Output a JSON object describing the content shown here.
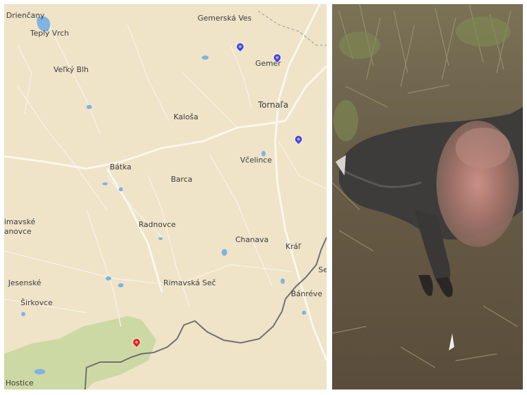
{
  "map": {
    "places": [
      {
        "id": "driencany",
        "name": "Drienčany"
      },
      {
        "id": "teply-vrch",
        "name": "Teplý Vrch"
      },
      {
        "id": "velky-blh",
        "name": "Veľký Blh"
      },
      {
        "id": "gemerska-ves",
        "name": "Gemerská Ves"
      },
      {
        "id": "gemer",
        "name": "Gemer"
      },
      {
        "id": "tornala",
        "name": "Tornaľa"
      },
      {
        "id": "kalosa",
        "name": "Kaloša"
      },
      {
        "id": "vcelince",
        "name": "Včelince"
      },
      {
        "id": "batka",
        "name": "Bátka"
      },
      {
        "id": "barca",
        "name": "Barca"
      },
      {
        "id": "rimavske-janovce-1",
        "name": "imavské"
      },
      {
        "id": "rimavske-janovce-2",
        "name": "anovce"
      },
      {
        "id": "radnovce",
        "name": "Radnovce"
      },
      {
        "id": "chanava",
        "name": "Chanava"
      },
      {
        "id": "kral",
        "name": "Kráľ"
      },
      {
        "id": "jesenske",
        "name": "Jesenské"
      },
      {
        "id": "rimavska-sec",
        "name": "Rimavská Seč"
      },
      {
        "id": "sirkovce",
        "name": "Širkovce"
      },
      {
        "id": "banreve",
        "name": "Bánréve"
      },
      {
        "id": "se",
        "name": "Se"
      },
      {
        "id": "hostice",
        "name": "Hostice"
      }
    ],
    "markers": [
      {
        "id": "blue-1",
        "color": "#4a45d6",
        "icon": "map-pin-icon"
      },
      {
        "id": "blue-2",
        "color": "#4a45d6",
        "icon": "map-pin-icon"
      },
      {
        "id": "blue-3",
        "color": "#4a45d6",
        "icon": "map-pin-icon"
      },
      {
        "id": "red-1",
        "color": "#e02020",
        "icon": "map-pin-icon"
      }
    ],
    "colors": {
      "land": "#efe3c8",
      "park": "#cdd9a4",
      "water": "#7fb3e0",
      "road": "#f7f1e4",
      "border": "#6f6f6f"
    }
  },
  "photo": {
    "subject": "wild boar carcass",
    "blurred_region": "face"
  }
}
